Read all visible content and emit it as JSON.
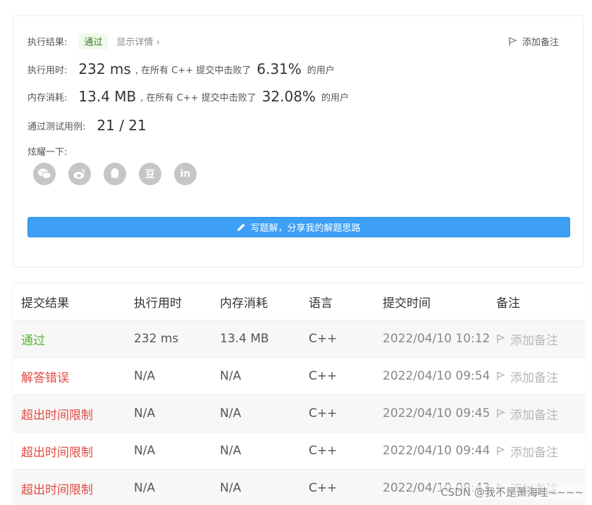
{
  "result": {
    "label": "执行结果:",
    "status": "通过",
    "detail_link": "显示详情 ›",
    "add_note": "添加备注"
  },
  "runtime": {
    "label": "执行用时:",
    "value": "232 ms",
    "prefix": ", 在所有 C++ 提交中击败了",
    "percent": "6.31%",
    "suffix": "的用户"
  },
  "memory": {
    "label": "内存消耗:",
    "value": "13.4 MB",
    "prefix": ", 在所有 C++ 提交中击败了",
    "percent": "32.08%",
    "suffix": "的用户"
  },
  "tests": {
    "label": "通过测试用例:",
    "value": "21 / 21"
  },
  "share": {
    "label": "炫耀一下:",
    "icons": [
      "wechat-icon",
      "weibo-icon",
      "qq-icon",
      "douban-icon",
      "linkedin-icon"
    ],
    "douban_glyph": "豆",
    "linkedin_glyph": "in"
  },
  "write_button": "写题解，分享我的解题思路",
  "table": {
    "headers": [
      "提交结果",
      "执行用时",
      "内存消耗",
      "语言",
      "提交时间",
      "备注"
    ],
    "rows": [
      {
        "status": "通过",
        "runtime": "232 ms",
        "memory": "13.4 MB",
        "lang": "C++",
        "time": "2022/04/10 10:12",
        "note": "添加备注"
      },
      {
        "status": "解答错误",
        "runtime": "N/A",
        "memory": "N/A",
        "lang": "C++",
        "time": "2022/04/10 09:54",
        "note": "添加备注"
      },
      {
        "status": "超出时间限制",
        "runtime": "N/A",
        "memory": "N/A",
        "lang": "C++",
        "time": "2022/04/10 09:45",
        "note": "添加备注"
      },
      {
        "status": "超出时间限制",
        "runtime": "N/A",
        "memory": "N/A",
        "lang": "C++",
        "time": "2022/04/10 09:44",
        "note": "添加备注"
      },
      {
        "status": "超出时间限制",
        "runtime": "N/A",
        "memory": "N/A",
        "lang": "C++",
        "time": "2022/04/10 09:43",
        "note": "添加备注"
      }
    ]
  },
  "watermark": "CSDN @我不是萧海哇~~~~",
  "colors": {
    "accent": "#3d9ff6",
    "pass": "#5cb335",
    "fail": "#e04a43"
  }
}
